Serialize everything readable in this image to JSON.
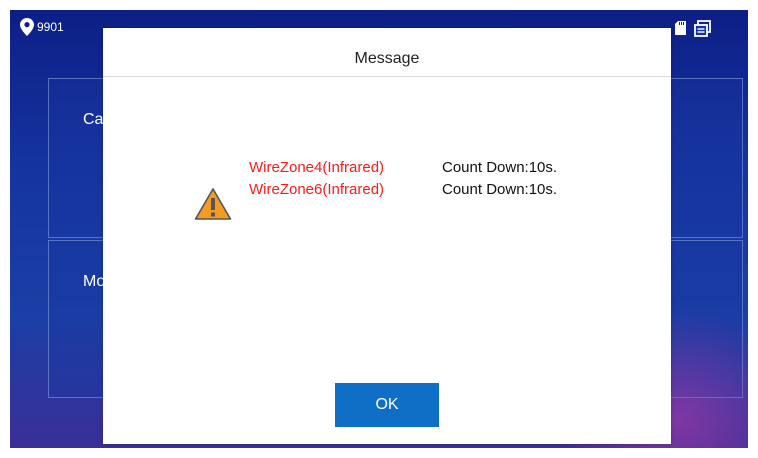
{
  "status_bar": {
    "room_number": "9901",
    "icons": [
      "location-pin-icon",
      "sd-card-icon",
      "window-switch-icon"
    ]
  },
  "background": {
    "card_labels": [
      "Ca",
      "Mo"
    ]
  },
  "dialog": {
    "title": "Message",
    "alarms": [
      {
        "zone": "WireZone4(Infrared)",
        "countdown": "Count Down:10s."
      },
      {
        "zone": "WireZone6(Infrared)",
        "countdown": "Count Down:10s."
      }
    ],
    "ok_label": "OK",
    "warning_icon": "warning-triangle-icon"
  },
  "colors": {
    "alarm_text": "#ff1a1a",
    "ok_button": "#0f6fc6",
    "warning_fill": "#f59a23"
  }
}
